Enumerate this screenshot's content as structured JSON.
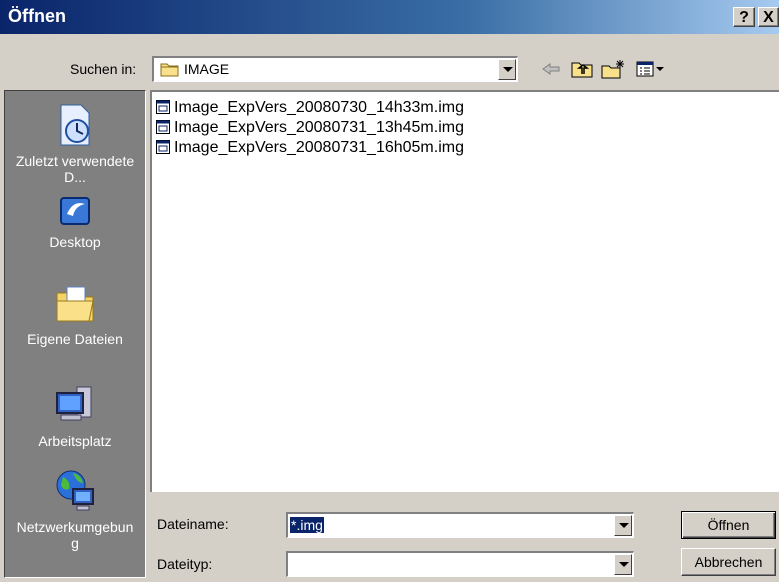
{
  "window": {
    "title": "Öffnen",
    "help_label": "?",
    "close_label": "X"
  },
  "lookin": {
    "label": "Suchen in:",
    "value": "IMAGE"
  },
  "toolbar": [
    "back-icon",
    "up-folder-icon",
    "new-folder-icon",
    "views-menu-icon"
  ],
  "places": [
    {
      "label": "Zuletzt verwendete D...",
      "icon": "recent-documents-icon"
    },
    {
      "label": "Desktop",
      "icon": "desktop-icon"
    },
    {
      "label": "Eigene Dateien",
      "icon": "my-documents-icon"
    },
    {
      "label": "Arbeitsplatz",
      "icon": "my-computer-icon"
    },
    {
      "label": "Netzwerkumgebung",
      "icon": "network-icon"
    }
  ],
  "files": [
    "Image_ExpVers_20080730_14h33m.img",
    "Image_ExpVers_20080731_13h45m.img",
    "Image_ExpVers_20080731_16h05m.img"
  ],
  "filename": {
    "label": "Dateiname:",
    "value": "*.img"
  },
  "filetype": {
    "label": "Dateityp:",
    "value": ""
  },
  "buttons": {
    "open": "Öffnen",
    "cancel": "Abbrechen"
  },
  "colors": {
    "title_start": "#0a246a",
    "title_end": "#a6caf0",
    "face": "#d4d0c8",
    "places_bg": "#808080"
  }
}
